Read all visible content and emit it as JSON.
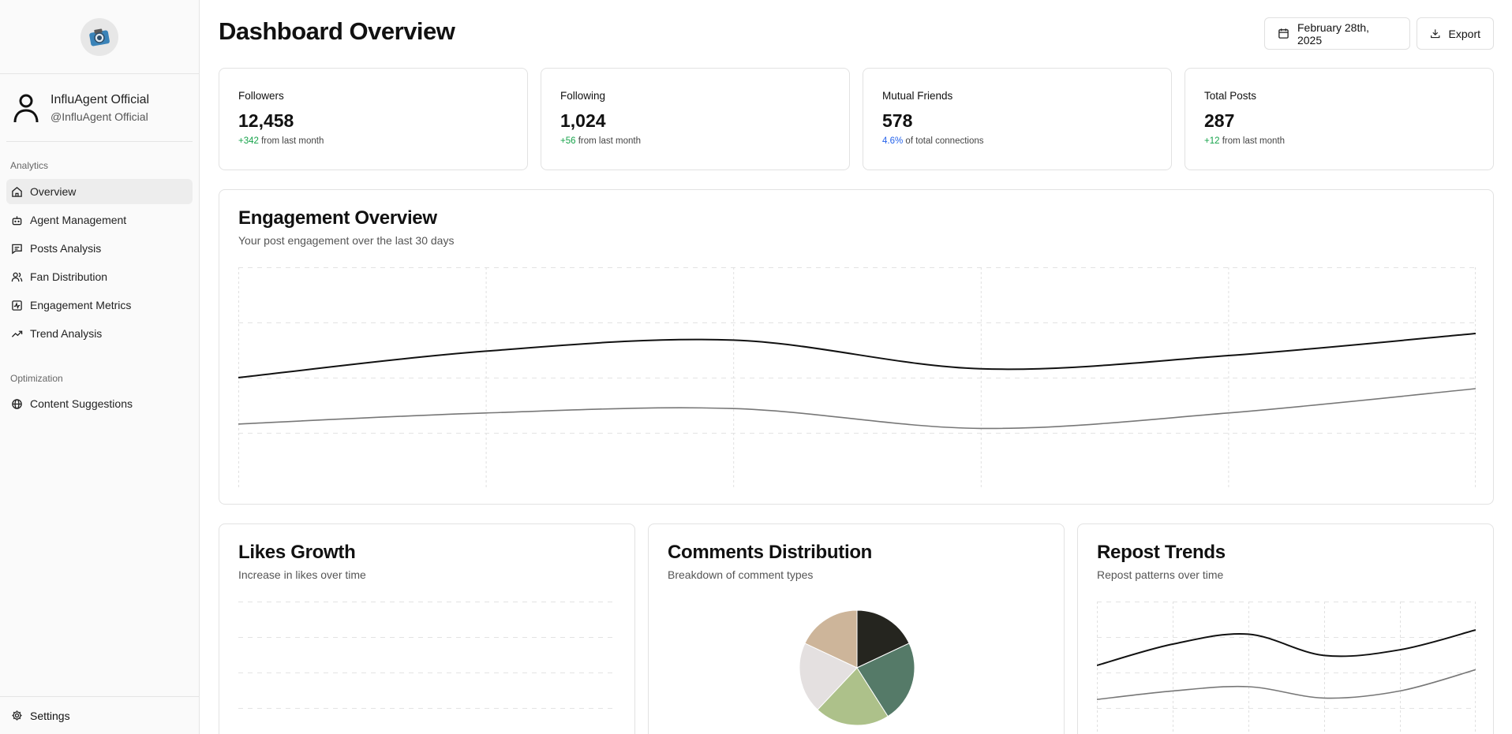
{
  "brand": {
    "logo_icon": "camera-logo-icon"
  },
  "profile": {
    "name": "InfluAgent Official",
    "handle": "@InfluAgent Official"
  },
  "sidebar": {
    "analytics_title": "Analytics",
    "analytics_items": [
      {
        "label": "Overview",
        "icon": "home-icon",
        "active": true
      },
      {
        "label": "Agent Management",
        "icon": "bot-icon"
      },
      {
        "label": "Posts Analysis",
        "icon": "message-icon"
      },
      {
        "label": "Fan Distribution",
        "icon": "users-icon"
      },
      {
        "label": "Engagement Metrics",
        "icon": "activity-icon"
      },
      {
        "label": "Trend Analysis",
        "icon": "trending-up-icon"
      }
    ],
    "optimization_title": "Optimization",
    "optimization_items": [
      {
        "label": "Content Suggestions",
        "icon": "globe-icon"
      }
    ],
    "settings_label": "Settings"
  },
  "header": {
    "title": "Dashboard Overview",
    "date_label": "February 28th, 2025",
    "export_label": "Export"
  },
  "stats": [
    {
      "label": "Followers",
      "value": "12,458",
      "delta": "+342",
      "delta_text": "from last month"
    },
    {
      "label": "Following",
      "value": "1,024",
      "delta": "+56",
      "delta_text": "from last month"
    },
    {
      "label": "Mutual Friends",
      "value": "578",
      "delta": "4.6%",
      "delta_text": "of total connections"
    },
    {
      "label": "Total Posts",
      "value": "287",
      "delta": "+12",
      "delta_text": "from last month"
    }
  ],
  "engagement": {
    "title": "Engagement Overview",
    "subtitle": "Your post engagement over the last 30 days"
  },
  "likes": {
    "title": "Likes Growth",
    "subtitle": "Increase in likes over time"
  },
  "comments": {
    "title": "Comments Distribution",
    "subtitle": "Breakdown of comment types"
  },
  "reposts": {
    "title": "Repost Trends",
    "subtitle": "Repost patterns over time"
  },
  "colors": {
    "positive": "#16a34a",
    "info": "#2563eb",
    "line_primary": "#111111",
    "line_secondary": "#777777",
    "pie": [
      "#25251f",
      "#557a68",
      "#adc18a",
      "#e4e0e0",
      "#cdb59a"
    ]
  },
  "chart_data": [
    {
      "type": "line",
      "title": "Engagement Overview",
      "x": [
        0,
        1,
        2,
        3,
        4,
        5
      ],
      "series": [
        {
          "values": [
            50,
            62,
            67,
            54,
            60,
            70
          ]
        },
        {
          "values": [
            29,
            34,
            36,
            27,
            34,
            45
          ]
        }
      ],
      "ylim": [
        0,
        100
      ],
      "grid": true
    },
    {
      "type": "line",
      "title": "Likes Growth",
      "series": [],
      "grid": true
    },
    {
      "type": "pie",
      "title": "Comments Distribution",
      "values": [
        18,
        23,
        21,
        20,
        18
      ]
    },
    {
      "type": "line",
      "title": "Repost Trends",
      "x": [
        0,
        1,
        2,
        3,
        4,
        5
      ],
      "series": [
        {
          "values": [
            55,
            70,
            77,
            62,
            66,
            80
          ]
        },
        {
          "values": [
            31,
            37,
            40,
            32,
            37,
            52
          ]
        }
      ],
      "ylim": [
        0,
        100
      ],
      "grid": true
    }
  ]
}
